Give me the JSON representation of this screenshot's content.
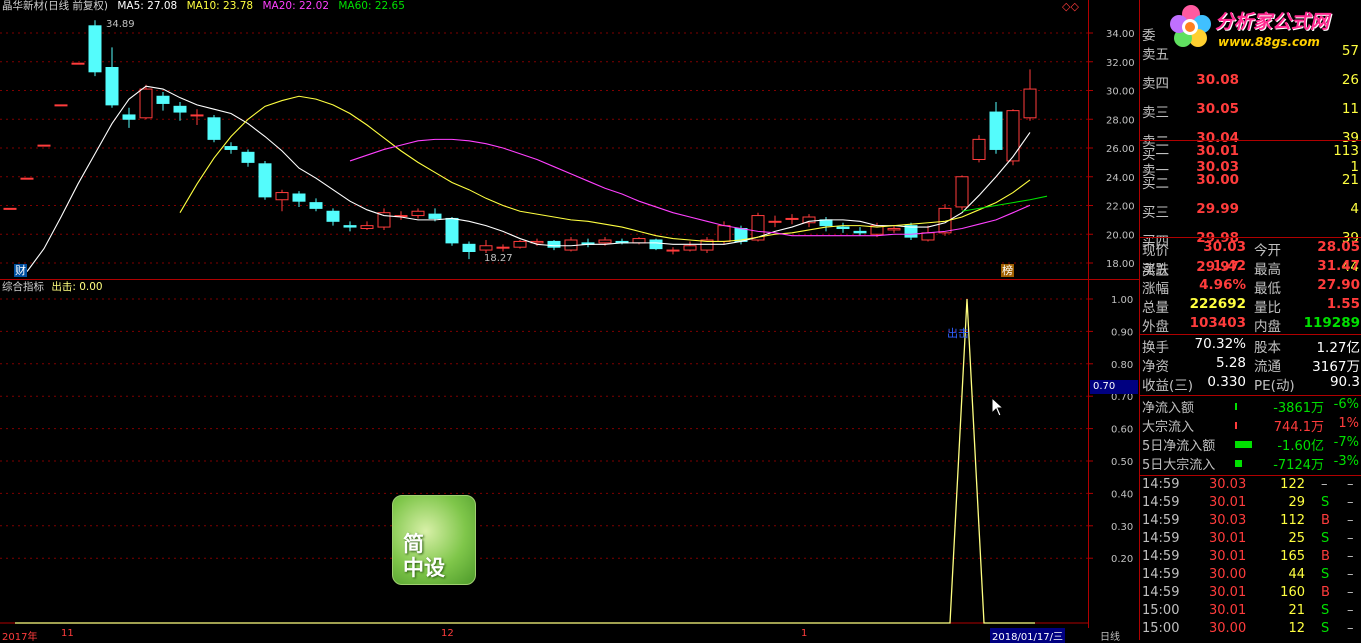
{
  "header": {
    "title": "晶华新材(日线 前复权)",
    "ma5": "MA5: 27.08",
    "ma10": "MA10: 23.78",
    "ma20": "MA20: 22.02",
    "ma60": "MA60: 22.65",
    "indicator": "综合指标",
    "indicator_value": "出击: 0.00"
  },
  "markers": {
    "high": "34.89",
    "low": "18.27",
    "signal": "出击",
    "cursor_value": "0.70",
    "cai_icon": "财",
    "bang_icon": "榜",
    "diamond_icon": "◇◇"
  },
  "timeline": {
    "y2017": "2017年",
    "m11": "11",
    "m12": "12",
    "m1": "1",
    "date": "2018/01/17/三",
    "period": "日线"
  },
  "logo": {
    "line1": "简",
    "line2": "中设"
  },
  "brand": {
    "name": "分析家公式网",
    "url": "www.88gs.com"
  },
  "colors": {
    "up": "#ff3c3c",
    "down": "#54fcfc",
    "ma5": "#ffffff",
    "ma10": "#ffff40",
    "ma20": "#ff40ff",
    "ma60": "#00e000",
    "grid": "#800000",
    "indicator": "#ffff80"
  },
  "chart_data": [
    {
      "type": "candlestick",
      "title": "晶华新材(日线 前复权)",
      "ylim": [
        17.0,
        35.5
      ],
      "yticks": [
        "34.00",
        "32.00",
        "30.00",
        "28.00",
        "26.00",
        "24.00",
        "22.00",
        "20.00",
        "18.00"
      ],
      "candles": [
        {
          "o": 21.8,
          "c": 21.8,
          "h": 21.8,
          "l": 21.8
        },
        {
          "o": 23.9,
          "c": 23.9,
          "h": 23.9,
          "l": 23.9
        },
        {
          "o": 26.2,
          "c": 26.2,
          "h": 26.2,
          "l": 26.2
        },
        {
          "o": 29.0,
          "c": 29.0,
          "h": 29.0,
          "l": 29.0
        },
        {
          "o": 31.9,
          "c": 31.9,
          "h": 31.9,
          "l": 31.9
        },
        {
          "o": 34.5,
          "c": 31.3,
          "h": 34.89,
          "l": 31.0
        },
        {
          "o": 31.6,
          "c": 29.0,
          "h": 33.0,
          "l": 28.8
        },
        {
          "o": 28.3,
          "c": 28.0,
          "h": 28.8,
          "l": 27.4
        },
        {
          "o": 28.1,
          "c": 30.1,
          "h": 30.4,
          "l": 28.0
        },
        {
          "o": 29.6,
          "c": 29.1,
          "h": 29.9,
          "l": 28.6
        },
        {
          "o": 28.9,
          "c": 28.5,
          "h": 29.2,
          "l": 27.9
        },
        {
          "o": 28.3,
          "c": 28.3,
          "h": 28.7,
          "l": 27.6
        },
        {
          "o": 28.1,
          "c": 26.6,
          "h": 28.3,
          "l": 26.4
        },
        {
          "o": 26.1,
          "c": 25.9,
          "h": 26.4,
          "l": 25.6
        },
        {
          "o": 25.7,
          "c": 25.0,
          "h": 25.9,
          "l": 24.7
        },
        {
          "o": 24.9,
          "c": 22.6,
          "h": 25.1,
          "l": 22.4
        },
        {
          "o": 22.4,
          "c": 22.9,
          "h": 23.1,
          "l": 21.6
        },
        {
          "o": 22.8,
          "c": 22.3,
          "h": 23.0,
          "l": 21.9
        },
        {
          "o": 22.2,
          "c": 21.8,
          "h": 22.5,
          "l": 21.6
        },
        {
          "o": 21.6,
          "c": 20.9,
          "h": 21.8,
          "l": 20.6
        },
        {
          "o": 20.6,
          "c": 20.5,
          "h": 20.9,
          "l": 20.2
        },
        {
          "o": 20.4,
          "c": 20.6,
          "h": 20.9,
          "l": 20.3
        },
        {
          "o": 20.5,
          "c": 21.5,
          "h": 21.8,
          "l": 20.3
        },
        {
          "o": 21.3,
          "c": 21.3,
          "h": 21.6,
          "l": 21.0
        },
        {
          "o": 21.3,
          "c": 21.6,
          "h": 21.8,
          "l": 21.1
        },
        {
          "o": 21.4,
          "c": 21.1,
          "h": 21.8,
          "l": 20.9
        },
        {
          "o": 21.1,
          "c": 19.4,
          "h": 21.2,
          "l": 19.2
        },
        {
          "o": 19.3,
          "c": 18.8,
          "h": 19.5,
          "l": 18.27
        },
        {
          "o": 18.9,
          "c": 19.2,
          "h": 19.6,
          "l": 18.7
        },
        {
          "o": 19.1,
          "c": 19.1,
          "h": 19.3,
          "l": 18.8
        },
        {
          "o": 19.1,
          "c": 19.5,
          "h": 19.6,
          "l": 19.0
        },
        {
          "o": 19.4,
          "c": 19.5,
          "h": 19.7,
          "l": 19.2
        },
        {
          "o": 19.5,
          "c": 19.1,
          "h": 19.6,
          "l": 18.9
        },
        {
          "o": 18.9,
          "c": 19.6,
          "h": 19.8,
          "l": 18.8
        },
        {
          "o": 19.4,
          "c": 19.3,
          "h": 19.7,
          "l": 19.1
        },
        {
          "o": 19.4,
          "c": 19.6,
          "h": 19.8,
          "l": 19.2
        },
        {
          "o": 19.5,
          "c": 19.4,
          "h": 19.7,
          "l": 19.3
        },
        {
          "o": 19.4,
          "c": 19.7,
          "h": 19.8,
          "l": 19.3
        },
        {
          "o": 19.6,
          "c": 19.0,
          "h": 19.7,
          "l": 18.9
        },
        {
          "o": 18.9,
          "c": 18.9,
          "h": 19.1,
          "l": 18.6
        },
        {
          "o": 18.9,
          "c": 19.2,
          "h": 19.5,
          "l": 18.8
        },
        {
          "o": 18.9,
          "c": 19.6,
          "h": 19.8,
          "l": 18.7
        },
        {
          "o": 19.5,
          "c": 20.6,
          "h": 20.9,
          "l": 19.3
        },
        {
          "o": 20.4,
          "c": 19.5,
          "h": 20.6,
          "l": 19.3
        },
        {
          "o": 19.6,
          "c": 21.3,
          "h": 21.5,
          "l": 19.5
        },
        {
          "o": 20.9,
          "c": 20.9,
          "h": 21.3,
          "l": 20.5
        },
        {
          "o": 21.1,
          "c": 21.1,
          "h": 21.4,
          "l": 20.7
        },
        {
          "o": 20.8,
          "c": 21.2,
          "h": 21.4,
          "l": 20.5
        },
        {
          "o": 21.0,
          "c": 20.6,
          "h": 21.2,
          "l": 20.2
        },
        {
          "o": 20.5,
          "c": 20.4,
          "h": 20.8,
          "l": 20.1
        },
        {
          "o": 20.2,
          "c": 20.1,
          "h": 20.5,
          "l": 19.9
        },
        {
          "o": 20.0,
          "c": 20.6,
          "h": 20.8,
          "l": 19.8
        },
        {
          "o": 20.3,
          "c": 20.4,
          "h": 20.6,
          "l": 20.1
        },
        {
          "o": 20.6,
          "c": 19.8,
          "h": 20.8,
          "l": 19.6
        },
        {
          "o": 19.6,
          "c": 20.1,
          "h": 20.6,
          "l": 19.5
        },
        {
          "o": 20.1,
          "c": 21.8,
          "h": 22.1,
          "l": 19.9
        },
        {
          "o": 21.9,
          "c": 24.0,
          "h": 24.1,
          "l": 21.7
        },
        {
          "o": 25.2,
          "c": 26.6,
          "h": 26.9,
          "l": 25.0
        },
        {
          "o": 28.5,
          "c": 25.9,
          "h": 29.2,
          "l": 25.6
        },
        {
          "o": 25.1,
          "c": 28.6,
          "h": 28.7,
          "l": 24.8
        },
        {
          "o": 28.1,
          "c": 30.1,
          "h": 31.47,
          "l": 27.9
        }
      ],
      "ma5": [
        17.4,
        19.0,
        21.2,
        23.5,
        25.6,
        27.7,
        29.4,
        30.3,
        30.1,
        29.5,
        29.0,
        28.7,
        28.4,
        27.7,
        26.8,
        25.8,
        24.6,
        23.9,
        23.1,
        22.3,
        21.7,
        21.3,
        21.2,
        21.0,
        21.0,
        21.1,
        20.9,
        20.6,
        20.2,
        19.7,
        19.3,
        19.2,
        19.2,
        19.3,
        19.3,
        19.4,
        19.4,
        19.4,
        19.3,
        19.3,
        19.3,
        19.3,
        19.5,
        19.8,
        20.2,
        20.5,
        20.9,
        21.0,
        21.0,
        20.9,
        20.6,
        20.6,
        20.5,
        20.5,
        20.8,
        21.5,
        22.7,
        24.0,
        25.4,
        27.08
      ],
      "ma10": [
        null,
        null,
        null,
        null,
        null,
        null,
        null,
        null,
        null,
        21.5,
        23.5,
        25.3,
        26.8,
        28.0,
        28.9,
        29.3,
        29.6,
        29.4,
        29.0,
        28.4,
        27.6,
        26.7,
        25.8,
        25.0,
        24.3,
        23.6,
        23.1,
        22.5,
        22.0,
        21.6,
        21.4,
        21.2,
        21.0,
        20.9,
        20.7,
        20.5,
        20.2,
        19.9,
        19.7,
        19.6,
        19.5,
        19.5,
        19.6,
        19.8,
        20.0,
        20.1,
        20.3,
        20.5,
        20.6,
        20.6,
        20.5,
        20.6,
        20.7,
        20.8,
        20.9,
        21.2,
        21.7,
        22.2,
        22.9,
        23.78
      ],
      "ma20": [
        null,
        null,
        null,
        null,
        null,
        null,
        null,
        null,
        null,
        null,
        null,
        null,
        null,
        null,
        null,
        null,
        null,
        null,
        null,
        25.1,
        25.5,
        25.9,
        26.2,
        26.5,
        26.6,
        26.6,
        26.5,
        26.3,
        26.0,
        25.6,
        25.2,
        24.7,
        24.2,
        23.7,
        23.2,
        22.8,
        22.3,
        21.9,
        21.5,
        21.2,
        20.9,
        20.6,
        20.4,
        20.2,
        20.1,
        19.9,
        19.9,
        19.9,
        19.9,
        19.9,
        19.9,
        20.0,
        20.0,
        20.1,
        20.2,
        20.4,
        20.7,
        21.0,
        21.5,
        22.02
      ],
      "ma60": [
        null,
        null,
        null,
        null,
        null,
        null,
        null,
        null,
        null,
        null,
        null,
        null,
        null,
        null,
        null,
        null,
        null,
        null,
        null,
        null,
        null,
        null,
        null,
        null,
        null,
        null,
        null,
        null,
        null,
        null,
        null,
        null,
        null,
        null,
        null,
        null,
        null,
        null,
        null,
        null,
        null,
        null,
        null,
        null,
        null,
        null,
        null,
        null,
        null,
        null,
        null,
        null,
        null,
        null,
        null,
        21.6,
        21.8,
        22.0,
        22.2,
        22.4,
        22.65
      ]
    },
    {
      "type": "line",
      "title": "综合指标",
      "ylim": [
        0,
        1.05
      ],
      "yticks": [
        "1.00",
        "0.90",
        "0.80",
        "0.70",
        "0.60",
        "0.50",
        "0.40",
        "0.30",
        "0.20"
      ],
      "series": [
        {
          "name": "出击",
          "values": [
            0,
            0,
            0,
            0,
            0,
            0,
            0,
            0,
            0,
            0,
            0,
            0,
            0,
            0,
            0,
            0,
            0,
            0,
            0,
            0,
            0,
            0,
            0,
            0,
            0,
            0,
            0,
            0,
            0,
            0,
            0,
            0,
            0,
            0,
            0,
            0,
            0,
            0,
            0,
            0,
            0,
            0,
            0,
            0,
            0,
            0,
            0,
            0,
            0,
            0,
            0,
            0,
            0,
            0,
            0,
            0,
            1.0,
            0,
            0,
            0,
            0
          ]
        }
      ]
    }
  ],
  "quote": {
    "sell_partial": "委",
    "sells": [
      {
        "label": "卖五",
        "price": "",
        "vol": "57"
      },
      {
        "label": "卖四",
        "price": "30.08",
        "vol": "26"
      },
      {
        "label": "卖三",
        "price": "30.05",
        "vol": "11"
      },
      {
        "label": "卖二",
        "price": "30.04",
        "vol": "39"
      },
      {
        "label": "卖一",
        "price": "30.03",
        "vol": "1"
      }
    ],
    "buys": [
      {
        "label": "买一",
        "price": "30.01",
        "vol": "113"
      },
      {
        "label": "买二",
        "price": "30.00",
        "vol": "21"
      },
      {
        "label": "买三",
        "price": "29.99",
        "vol": "4"
      },
      {
        "label": "买四",
        "price": "29.98",
        "vol": "39"
      },
      {
        "label": "买五",
        "price": "29.97",
        "vol": "44"
      }
    ],
    "stats": [
      {
        "l1": "现价",
        "v1": "30.03",
        "l2": "今开",
        "v2": "28.05",
        "c1": "#ff3c3c",
        "c2": "#ff3c3c"
      },
      {
        "l1": "涨跌",
        "v1": "1.42",
        "l2": "最高",
        "v2": "31.47",
        "c1": "#ff3c3c",
        "c2": "#ff3c3c"
      },
      {
        "l1": "涨幅",
        "v1": "4.96%",
        "l2": "最低",
        "v2": "27.90",
        "c1": "#ff3c3c",
        "c2": "#ff3c3c"
      },
      {
        "l1": "总量",
        "v1": "222692",
        "l2": "量比",
        "v2": "1.55",
        "c1": "#ffff40",
        "c2": "#ff3c3c"
      },
      {
        "l1": "外盘",
        "v1": "103403",
        "l2": "内盘",
        "v2": "119289",
        "c1": "#ff3c3c",
        "c2": "#00e000"
      }
    ],
    "fund": [
      {
        "l1": "换手",
        "v1": "70.32%",
        "l2": "股本",
        "v2": "1.27亿"
      },
      {
        "l1": "净资",
        "v1": "5.28",
        "l2": "流通",
        "v2": "3167万"
      },
      {
        "l1": "收益(三)",
        "v1": "0.330",
        "l2": "PE(动)",
        "v2": "90.3"
      }
    ],
    "flows": [
      {
        "label": "净流入额",
        "value": "-3861万",
        "pct": "-6%",
        "color": "#00e000",
        "bar": 0.1
      },
      {
        "label": "大宗流入",
        "value": "744.1万",
        "pct": "1%",
        "color": "#ff3c3c",
        "bar": 0.02
      },
      {
        "label": "5日净流入额",
        "value": "-1.60亿",
        "pct": "-7%",
        "color": "#00e000",
        "bar": 0.7
      },
      {
        "label": "5日大宗流入",
        "value": "-7124万",
        "pct": "-3%",
        "color": "#00e000",
        "bar": 0.3
      }
    ],
    "ticks": [
      {
        "t": "14:59",
        "p": "30.03",
        "v": "122",
        "d": "–",
        "pc": "#ff3c3c",
        "dc": "#c0c0c0"
      },
      {
        "t": "14:59",
        "p": "30.01",
        "v": "29",
        "d": "S",
        "pc": "#ff3c3c",
        "dc": "#00e000"
      },
      {
        "t": "14:59",
        "p": "30.03",
        "v": "112",
        "d": "B",
        "pc": "#ff3c3c",
        "dc": "#ff3c3c"
      },
      {
        "t": "14:59",
        "p": "30.01",
        "v": "25",
        "d": "S",
        "pc": "#ff3c3c",
        "dc": "#00e000"
      },
      {
        "t": "14:59",
        "p": "30.01",
        "v": "165",
        "d": "B",
        "pc": "#ff3c3c",
        "dc": "#ff3c3c"
      },
      {
        "t": "14:59",
        "p": "30.00",
        "v": "44",
        "d": "S",
        "pc": "#ff3c3c",
        "dc": "#00e000"
      },
      {
        "t": "14:59",
        "p": "30.01",
        "v": "160",
        "d": "B",
        "pc": "#ff3c3c",
        "dc": "#ff3c3c"
      },
      {
        "t": "15:00",
        "p": "30.01",
        "v": "21",
        "d": "S",
        "pc": "#ff3c3c",
        "dc": "#00e000"
      },
      {
        "t": "15:00",
        "p": "30.00",
        "v": "12",
        "d": "S",
        "pc": "#ff3c3c",
        "dc": "#00e000"
      }
    ]
  }
}
